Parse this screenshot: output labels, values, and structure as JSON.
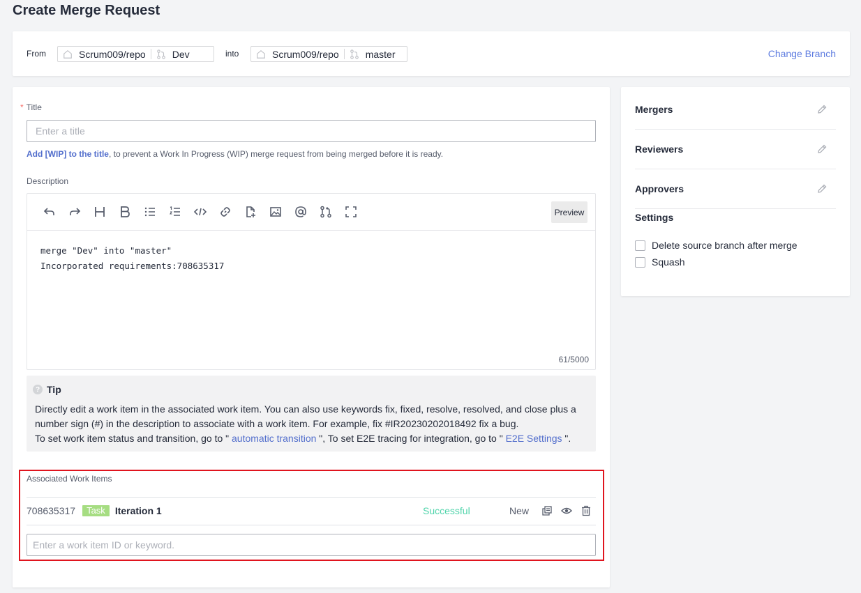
{
  "page": {
    "title": "Create Merge Request"
  },
  "branch": {
    "from_label": "From",
    "source_repo": "Scrum009/repo",
    "source_branch": "Dev",
    "into_label": "into",
    "target_repo": "Scrum009/repo",
    "target_branch": "master",
    "change_branch": "Change Branch"
  },
  "form": {
    "title_label": "Title",
    "title_required": "*",
    "title_placeholder": "Enter a title",
    "wip_link": "Add [WIP] to the title",
    "wip_text": ", to prevent a Work In Progress (WIP) merge request from being merged before it is ready.",
    "description_label": "Description",
    "preview": "Preview",
    "description_line1": "merge \"Dev\" into \"master\"",
    "description_line2": "Incorporated requirements:708635317",
    "char_count": "61/5000"
  },
  "toolbar_icons": [
    "undo-icon",
    "redo-icon",
    "heading-icon",
    "bold-icon",
    "bullet-list-icon",
    "ordered-list-icon",
    "code-icon",
    "link-icon",
    "attachment-icon",
    "image-icon",
    "mention-icon",
    "merge-request-icon",
    "fullscreen-icon"
  ],
  "tip": {
    "title": "Tip",
    "line1": "Directly edit a work item in the associated work item. You can also use keywords fix, fixed, resolve, resolved, and close plus a number sign (#) in the description to associate with a work item. For example, fix #IR20230202018492 fix a bug.",
    "line2_a": "To set work item status and transition, go to \" ",
    "link1": "automatic transition",
    "line2_b": " \", To set E2E tracing for integration, go to \" ",
    "link2": "E2E Settings",
    "line2_c": " \"."
  },
  "assoc": {
    "label": "Associated Work Items",
    "item": {
      "id": "708635317",
      "type": "Task",
      "name": "Iteration 1",
      "status": "Successful",
      "state": "New"
    },
    "input_placeholder": "Enter a work item ID or keyword."
  },
  "side": {
    "mergers": "Mergers",
    "reviewers": "Reviewers",
    "approvers": "Approvers",
    "settings": "Settings",
    "delete_source": "Delete source branch after merge",
    "squash": "Squash"
  },
  "colors": {
    "accent": "#5e7ce0",
    "link": "#526ecc",
    "success": "#50d4ab",
    "task_badge": "#a6dd82",
    "highlight_border": "#e0141e"
  }
}
